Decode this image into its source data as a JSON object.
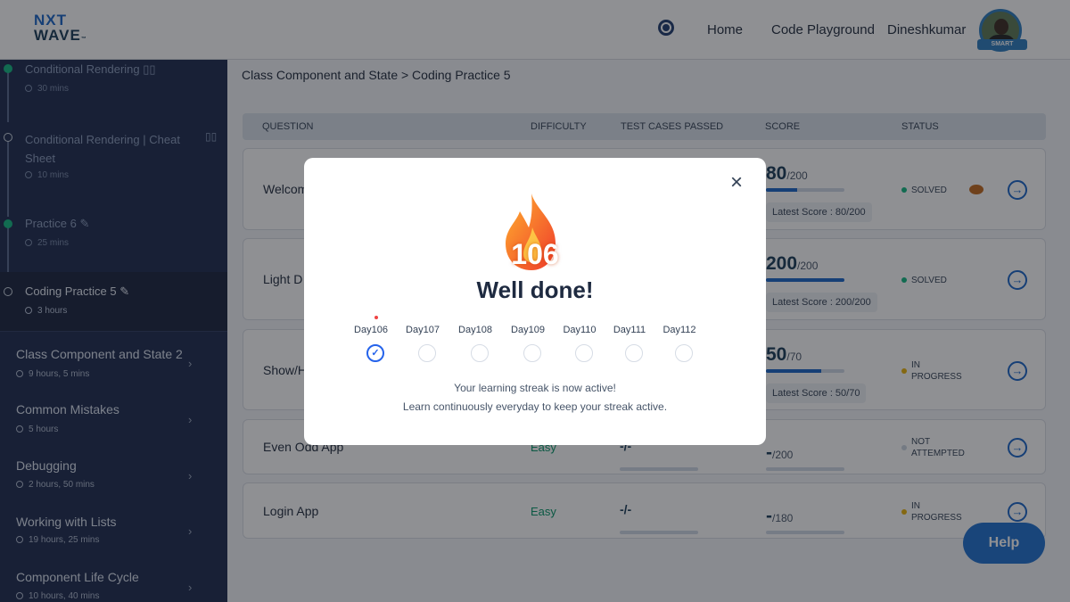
{
  "header": {
    "logo": "NXT WAVE",
    "nav": [
      "Home",
      "Code Playground"
    ],
    "user": "Dineshkumar",
    "badge": "SMART"
  },
  "sidebar": {
    "modules": [
      {
        "title": "Conditional Rendering",
        "duration": "30 mins",
        "state": "done",
        "icon": "book"
      },
      {
        "title": "Conditional Rendering | Cheat",
        "title2": "Sheet",
        "duration": "10 mins",
        "state": "open",
        "icon": "book"
      },
      {
        "title": "Practice 6",
        "duration": "25 mins",
        "state": "done",
        "icon": "pencil"
      },
      {
        "title": "Coding Practice 5",
        "duration": "3 hours",
        "state": "open",
        "icon": "pencil",
        "active": true
      }
    ],
    "sections": [
      {
        "title": "Class Component and State 2",
        "duration": "9 hours, 5 mins"
      },
      {
        "title": "Common Mistakes",
        "duration": "5 hours"
      },
      {
        "title": "Debugging",
        "duration": "2 hours, 50 mins"
      },
      {
        "title": "Working with Lists",
        "duration": "19 hours, 25 mins"
      },
      {
        "title": "Component Life Cycle",
        "duration": "10 hours, 40 mins"
      }
    ]
  },
  "breadcrumb": "Class Component and State > Coding Practice 5",
  "table": {
    "headers": [
      "QUESTION",
      "DIFFICULTY",
      "TEST CASES PASSED",
      "SCORE",
      "STATUS"
    ],
    "rows": [
      {
        "question": "Welcom",
        "score": "80",
        "max": "/200",
        "progress": 40,
        "latest": "Latest Score : 80/200",
        "status": "SOLVED",
        "status2": "",
        "statusColor": "#10b981",
        "eye": true
      },
      {
        "question": "Light D",
        "score": "200",
        "max": "/200",
        "progress": 100,
        "latest": "Latest Score : 200/200",
        "status": "SOLVED",
        "status2": "",
        "statusColor": "#10b981"
      },
      {
        "question": "Show/H",
        "score": "50",
        "max": "/70",
        "progress": 71,
        "latest": "Latest Score : 50/70",
        "status": "IN",
        "status2": "PROGRESS",
        "statusColor": "#eab308"
      },
      {
        "question": "Even Odd App",
        "difficulty": "Easy",
        "tests": "-/-",
        "score": "-",
        "max": "/200",
        "progress": 0,
        "status": "NOT",
        "status2": "ATTEMPTED",
        "statusColor": "#cbd5e1"
      },
      {
        "question": "Login App",
        "difficulty": "Easy",
        "tests": "-/-",
        "score": "-",
        "max": "/180",
        "progress": 0,
        "status": "IN",
        "status2": "PROGRESS",
        "statusColor": "#eab308"
      }
    ]
  },
  "help": "Help",
  "modal": {
    "streak": "106",
    "title": "Well done!",
    "days": [
      "Day106",
      "Day107",
      "Day108",
      "Day109",
      "Day110",
      "Day111",
      "Day112"
    ],
    "completed": [
      "Day106"
    ],
    "line1": "Your learning streak is now active!",
    "line2": "Learn continuously everyday to keep your streak active.",
    "close": "×",
    "accent": "#2563eb"
  }
}
